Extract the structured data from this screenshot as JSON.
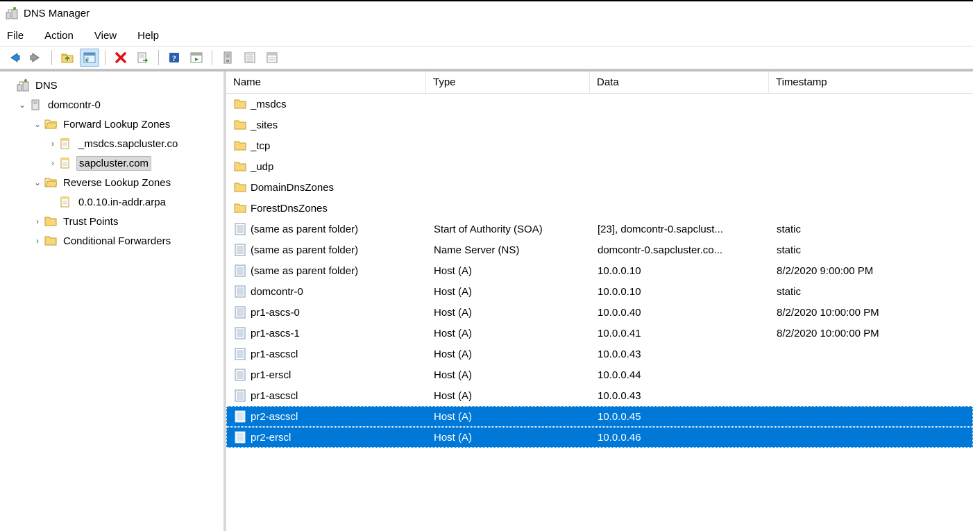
{
  "window": {
    "title": "DNS Manager"
  },
  "menu": {
    "file": "File",
    "action": "Action",
    "view": "View",
    "help": "Help"
  },
  "tree": {
    "root": "DNS",
    "server": "domcontr-0",
    "forward_zones": "Forward Lookup Zones",
    "zone_msdcs": "_msdcs.sapcluster.co",
    "zone_main": "sapcluster.com",
    "reverse_zones": "Reverse Lookup Zones",
    "zone_reverse": "0.0.10.in-addr.arpa",
    "trust_points": "Trust Points",
    "cond_forwarders": "Conditional Forwarders"
  },
  "columns": {
    "name": "Name",
    "type": "Type",
    "data": "Data",
    "timestamp": "Timestamp"
  },
  "records": [
    {
      "icon": "folder",
      "name": "_msdcs",
      "type": "",
      "data": "",
      "ts": "",
      "sel": false
    },
    {
      "icon": "folder",
      "name": "_sites",
      "type": "",
      "data": "",
      "ts": "",
      "sel": false
    },
    {
      "icon": "folder",
      "name": "_tcp",
      "type": "",
      "data": "",
      "ts": "",
      "sel": false
    },
    {
      "icon": "folder",
      "name": "_udp",
      "type": "",
      "data": "",
      "ts": "",
      "sel": false
    },
    {
      "icon": "folder",
      "name": "DomainDnsZones",
      "type": "",
      "data": "",
      "ts": "",
      "sel": false
    },
    {
      "icon": "folder",
      "name": "ForestDnsZones",
      "type": "",
      "data": "",
      "ts": "",
      "sel": false
    },
    {
      "icon": "record",
      "name": "(same as parent folder)",
      "type": "Start of Authority (SOA)",
      "data": "[23], domcontr-0.sapclust...",
      "ts": "static",
      "sel": false
    },
    {
      "icon": "record",
      "name": "(same as parent folder)",
      "type": "Name Server (NS)",
      "data": "domcontr-0.sapcluster.co...",
      "ts": "static",
      "sel": false
    },
    {
      "icon": "record",
      "name": "(same as parent folder)",
      "type": "Host (A)",
      "data": "10.0.0.10",
      "ts": "8/2/2020 9:00:00 PM",
      "sel": false
    },
    {
      "icon": "record",
      "name": "domcontr-0",
      "type": "Host (A)",
      "data": "10.0.0.10",
      "ts": "static",
      "sel": false
    },
    {
      "icon": "record",
      "name": "pr1-ascs-0",
      "type": "Host (A)",
      "data": "10.0.0.40",
      "ts": "8/2/2020 10:00:00 PM",
      "sel": false
    },
    {
      "icon": "record",
      "name": "pr1-ascs-1",
      "type": "Host (A)",
      "data": "10.0.0.41",
      "ts": "8/2/2020 10:00:00 PM",
      "sel": false
    },
    {
      "icon": "record",
      "name": "pr1-ascscl",
      "type": "Host (A)",
      "data": "10.0.0.43",
      "ts": "",
      "sel": false
    },
    {
      "icon": "record",
      "name": "pr1-erscl",
      "type": "Host (A)",
      "data": "10.0.0.44",
      "ts": "",
      "sel": false
    },
    {
      "icon": "record",
      "name": "pr1-ascscl",
      "type": "Host (A)",
      "data": "10.0.0.43",
      "ts": "",
      "sel": false
    },
    {
      "icon": "record",
      "name": "pr2-ascscl",
      "type": "Host (A)",
      "data": "10.0.0.45",
      "ts": "",
      "sel": true
    },
    {
      "icon": "record",
      "name": "pr2-erscl",
      "type": "Host (A)",
      "data": "10.0.0.46",
      "ts": "",
      "sel": true
    }
  ]
}
